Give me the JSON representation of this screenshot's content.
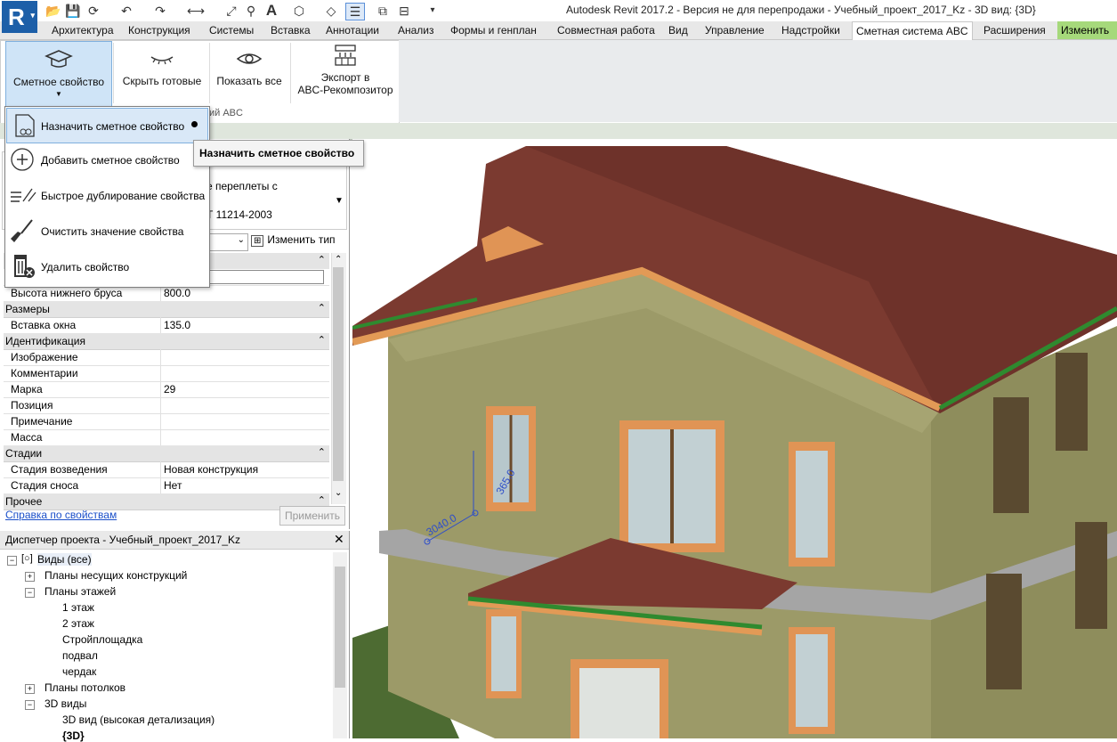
{
  "titlebar": {
    "logo": "R",
    "title": "Autodesk Revit 2017.2 - Версия не для перепродажи -    Учебный_проект_2017_Kz - 3D вид: {3D}"
  },
  "tabs": [
    {
      "label": "Архитектура"
    },
    {
      "label": "Конструкция"
    },
    {
      "label": "Системы"
    },
    {
      "label": "Вставка"
    },
    {
      "label": "Аннотации"
    },
    {
      "label": "Анализ"
    },
    {
      "label": "Формы и генплан"
    },
    {
      "label": "Совместная работа"
    },
    {
      "label": "Вид"
    },
    {
      "label": "Управление"
    },
    {
      "label": "Надстройки"
    },
    {
      "label": "Сметная система ABC"
    },
    {
      "label": "Расширения"
    },
    {
      "label": "Изменить"
    }
  ],
  "ribbon": {
    "btn_smetnoe": "Сметное свойство",
    "btn_hide": "Скрыть готовые",
    "btn_show": "Показать все",
    "btn_export_1": "Экспорт в",
    "btn_export_2": "ABC-Рекомпозитор",
    "panel_label": "ий ABC"
  },
  "menu": {
    "items": [
      {
        "label": "Назначить сметное свойство"
      },
      {
        "label": "Добавить сметное свойство"
      },
      {
        "label": "Быстрое дублирование свойства"
      },
      {
        "label": "Очистить значение свойства"
      },
      {
        "label": "Удалить свойство"
      }
    ],
    "tooltip": "Назначить сметное свойство"
  },
  "properties": {
    "type_line1": "е переплеты с",
    "type_line2": "Т 11214-2003",
    "edit_type": "Изменить тип",
    "rows": [
      {
        "kind": "row",
        "key": "Высота нижнего бруса",
        "value": "800.0"
      },
      {
        "kind": "group",
        "key": "Размеры"
      },
      {
        "kind": "row",
        "key": "Вставка окна",
        "value": "135.0"
      },
      {
        "kind": "group",
        "key": "Идентификация"
      },
      {
        "kind": "row",
        "key": "Изображение",
        "value": ""
      },
      {
        "kind": "row",
        "key": "Комментарии",
        "value": ""
      },
      {
        "kind": "row",
        "key": "Марка",
        "value": "29"
      },
      {
        "kind": "row",
        "key": "Позиция",
        "value": ""
      },
      {
        "kind": "row",
        "key": "Примечание",
        "value": ""
      },
      {
        "kind": "row",
        "key": "Масса",
        "value": ""
      },
      {
        "kind": "group",
        "key": "Стадии"
      },
      {
        "kind": "row",
        "key": "Стадия возведения",
        "value": "Новая конструкция"
      },
      {
        "kind": "row",
        "key": "Стадия сноса",
        "value": "Нет"
      },
      {
        "kind": "group",
        "key": "Прочее"
      }
    ],
    "help": "Справка по свойствам",
    "apply": "Применить"
  },
  "browser": {
    "title": "Диспетчер проекта - Учебный_проект_2017_Kz",
    "nodes": [
      {
        "label": "Виды (все)",
        "level": 0,
        "box": "-"
      },
      {
        "label": "Планы несущих конструкций",
        "level": 1,
        "box": "+"
      },
      {
        "label": "Планы этажей",
        "level": 1,
        "box": "-"
      },
      {
        "label": "1 этаж",
        "level": 2,
        "box": ""
      },
      {
        "label": "2 этаж",
        "level": 2,
        "box": ""
      },
      {
        "label": "Стройплощадка",
        "level": 2,
        "box": ""
      },
      {
        "label": "подвал",
        "level": 2,
        "box": ""
      },
      {
        "label": "чердак",
        "level": 2,
        "box": ""
      },
      {
        "label": "Планы потолков",
        "level": 1,
        "box": "+"
      },
      {
        "label": "3D виды",
        "level": 1,
        "box": "-"
      },
      {
        "label": "3D вид (высокая детализация)",
        "level": 2,
        "box": ""
      },
      {
        "label": "{3D}",
        "level": 2,
        "box": ""
      }
    ]
  },
  "viewport": {
    "dim_1": "3040.0",
    "dim_2": "365.0"
  }
}
